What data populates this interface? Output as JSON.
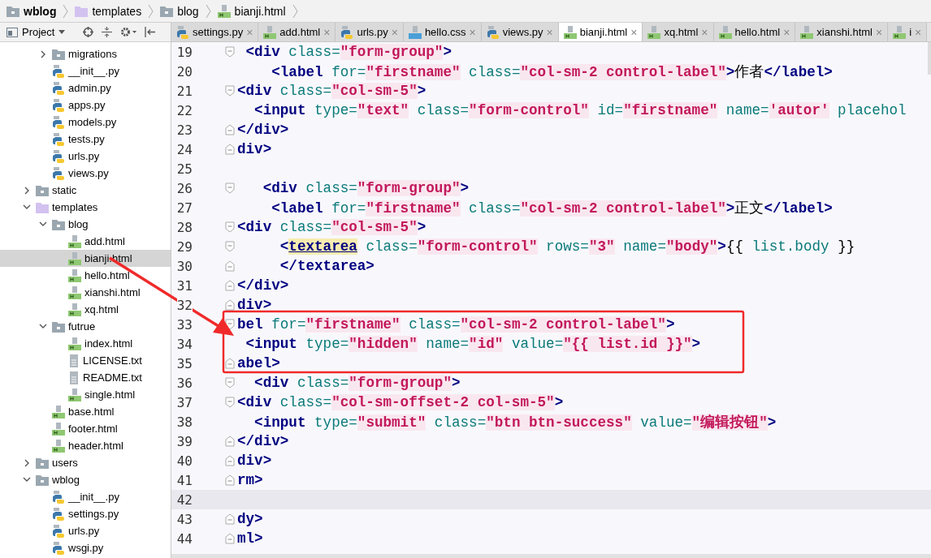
{
  "breadcrumb": [
    {
      "label": "wblog",
      "kind": "folder",
      "bold": true
    },
    {
      "label": "templates",
      "kind": "template-folder",
      "bold": false
    },
    {
      "label": "blog",
      "kind": "folder",
      "bold": false
    },
    {
      "label": "bianji.html",
      "kind": "html",
      "bold": false
    }
  ],
  "project_toolbar": {
    "title": "Project"
  },
  "tree_continued": [
    {
      "label": "migrations",
      "kind": "folder",
      "expanded": false,
      "selected": false
    },
    {
      "label": "__init__.py",
      "kind": "py",
      "selected": false
    },
    {
      "label": "admin.py",
      "kind": "py",
      "selected": false
    },
    {
      "label": "apps.py",
      "kind": "py",
      "selected": false
    },
    {
      "label": "models.py",
      "kind": "py",
      "selected": false
    },
    {
      "label": "tests.py",
      "kind": "py",
      "selected": false
    },
    {
      "label": "urls.py",
      "kind": "py",
      "selected": false
    },
    {
      "label": "views.py",
      "kind": "py",
      "selected": false
    }
  ],
  "tree": [
    {
      "label": "static",
      "kind": "folder",
      "expanded": false,
      "selected": false
    },
    {
      "label": "templates",
      "kind": "template-folder",
      "expanded": true,
      "selected": false,
      "children": [
        {
          "label": "blog",
          "kind": "folder",
          "expanded": true,
          "selected": false,
          "children": [
            {
              "label": "add.html",
              "kind": "html",
              "selected": false
            },
            {
              "label": "bianji.html",
              "kind": "html",
              "selected": true
            },
            {
              "label": "hello.html",
              "kind": "html",
              "selected": false
            },
            {
              "label": "xianshi.html",
              "kind": "html",
              "selected": false
            },
            {
              "label": "xq.html",
              "kind": "html",
              "selected": false
            }
          ]
        },
        {
          "label": "futrue",
          "kind": "folder",
          "expanded": true,
          "selected": false,
          "children": [
            {
              "label": "index.html",
              "kind": "html",
              "selected": false
            },
            {
              "label": "LICENSE.txt",
              "kind": "txt",
              "selected": false
            },
            {
              "label": "README.txt",
              "kind": "txt",
              "selected": false
            },
            {
              "label": "single.html",
              "kind": "html",
              "selected": false
            }
          ]
        },
        {
          "label": "base.html",
          "kind": "html",
          "selected": false
        },
        {
          "label": "footer.html",
          "kind": "html",
          "selected": false
        },
        {
          "label": "header.html",
          "kind": "html",
          "selected": false
        }
      ]
    },
    {
      "label": "users",
      "kind": "folder",
      "expanded": false,
      "selected": false
    },
    {
      "label": "wblog",
      "kind": "folder",
      "expanded": true,
      "selected": false,
      "children": [
        {
          "label": "__init__.py",
          "kind": "py",
          "selected": false
        },
        {
          "label": "settings.py",
          "kind": "py",
          "selected": false
        },
        {
          "label": "urls.py",
          "kind": "py",
          "selected": false
        },
        {
          "label": "wsgi.py",
          "kind": "py",
          "selected": false
        }
      ]
    }
  ],
  "tabs": [
    {
      "label": "settings.py",
      "kind": "py",
      "selected": false
    },
    {
      "label": "add.html",
      "kind": "html",
      "selected": false
    },
    {
      "label": "urls.py",
      "kind": "py",
      "selected": false
    },
    {
      "label": "hello.css",
      "kind": "css",
      "selected": false
    },
    {
      "label": "views.py",
      "kind": "py",
      "selected": false
    },
    {
      "label": "bianji.html",
      "kind": "html",
      "selected": true
    },
    {
      "label": "xq.html",
      "kind": "html",
      "selected": false
    },
    {
      "label": "hello.html",
      "kind": "html",
      "selected": false
    },
    {
      "label": "xianshi.html",
      "kind": "html",
      "selected": false
    },
    {
      "label": "i",
      "kind": "html",
      "selected": false
    }
  ],
  "tab_close": "×",
  "code_lines": [
    {
      "number": "19",
      "fold_start": true,
      "fold_end": false,
      "current": false,
      "tokens": [
        {
          "kind": "tag",
          "text": " <div"
        },
        {
          "kind": "attr",
          "text": " class="
        },
        {
          "kind": "str",
          "text": "\"form-group\""
        },
        {
          "kind": "tag",
          "text": ">"
        }
      ]
    },
    {
      "number": "20",
      "fold_start": false,
      "fold_end": false,
      "current": false,
      "tokens": [
        {
          "kind": "tag",
          "text": "    <label"
        },
        {
          "kind": "attr",
          "text": " for="
        },
        {
          "kind": "str",
          "text": "\"firstname\""
        },
        {
          "kind": "attr",
          "text": " class="
        },
        {
          "kind": "str",
          "text": "\"col-sm-2 control-label\""
        },
        {
          "kind": "tag",
          "text": ">"
        },
        {
          "kind": "text",
          "text": "作者"
        },
        {
          "kind": "tag",
          "text": "</label>"
        }
      ]
    },
    {
      "number": "21",
      "fold_start": true,
      "fold_end": false,
      "current": false,
      "tokens": [
        {
          "kind": "tag",
          "text": "<div"
        },
        {
          "kind": "attr",
          "text": " class="
        },
        {
          "kind": "str",
          "text": "\"col-sm-5\""
        },
        {
          "kind": "tag",
          "text": ">"
        }
      ]
    },
    {
      "number": "22",
      "fold_start": false,
      "fold_end": false,
      "current": false,
      "tokens": [
        {
          "kind": "tag",
          "text": "  <input"
        },
        {
          "kind": "attr",
          "text": " type="
        },
        {
          "kind": "str",
          "text": "\"text\""
        },
        {
          "kind": "attr",
          "text": " class="
        },
        {
          "kind": "str",
          "text": "\"form-control\""
        },
        {
          "kind": "attr",
          "text": " id="
        },
        {
          "kind": "str",
          "text": "\"firstname\""
        },
        {
          "kind": "attr",
          "text": " name="
        },
        {
          "kind": "str",
          "text": "'autor'"
        },
        {
          "kind": "attr",
          "text": " placehol"
        }
      ]
    },
    {
      "number": "23",
      "fold_start": false,
      "fold_end": true,
      "current": false,
      "tokens": [
        {
          "kind": "tag",
          "text": "</div>"
        }
      ]
    },
    {
      "number": "24",
      "fold_start": false,
      "fold_end": true,
      "current": false,
      "tokens": [
        {
          "kind": "tag",
          "text": "div>"
        }
      ]
    },
    {
      "number": "25",
      "fold_start": false,
      "fold_end": false,
      "current": false
    },
    {
      "number": "26",
      "fold_start": true,
      "fold_end": false,
      "current": false,
      "tokens": [
        {
          "kind": "tag",
          "text": "   <div"
        },
        {
          "kind": "attr",
          "text": " class="
        },
        {
          "kind": "str",
          "text": "\"form-group\""
        },
        {
          "kind": "tag",
          "text": ">"
        }
      ]
    },
    {
      "number": "27",
      "fold_start": false,
      "fold_end": false,
      "current": false,
      "tokens": [
        {
          "kind": "tag",
          "text": "    <label"
        },
        {
          "kind": "attr",
          "text": " for="
        },
        {
          "kind": "str",
          "text": "\"firstname\""
        },
        {
          "kind": "attr",
          "text": " class="
        },
        {
          "kind": "str",
          "text": "\"col-sm-2 control-label\""
        },
        {
          "kind": "tag",
          "text": ">"
        },
        {
          "kind": "text",
          "text": "正文"
        },
        {
          "kind": "tag",
          "text": "</label>"
        }
      ]
    },
    {
      "number": "28",
      "fold_start": true,
      "fold_end": false,
      "current": false,
      "tokens": [
        {
          "kind": "tag",
          "text": "<div"
        },
        {
          "kind": "attr",
          "text": " class="
        },
        {
          "kind": "str",
          "text": "\"col-sm-5\""
        },
        {
          "kind": "tag",
          "text": ">"
        }
      ]
    },
    {
      "number": "29",
      "fold_start": true,
      "fold_end": false,
      "current": false,
      "tokens": [
        {
          "kind": "tag",
          "text": "     <"
        },
        {
          "kind": "match",
          "text": "textarea"
        },
        {
          "kind": "attr",
          "text": " class="
        },
        {
          "kind": "str",
          "text": "\"form-control\""
        },
        {
          "kind": "attr",
          "text": " rows="
        },
        {
          "kind": "str",
          "text": "\"3\""
        },
        {
          "kind": "attr",
          "text": " name="
        },
        {
          "kind": "str",
          "text": "\"body\""
        },
        {
          "kind": "tag",
          "text": ">"
        },
        {
          "kind": "text",
          "text": "{{ "
        },
        {
          "kind": "var",
          "text": "list.body"
        },
        {
          "kind": "text",
          "text": " }}"
        }
      ]
    },
    {
      "number": "30",
      "fold_start": false,
      "fold_end": true,
      "current": false,
      "tokens": [
        {
          "kind": "tag",
          "text": "     </textarea>"
        }
      ]
    },
    {
      "number": "31",
      "fold_start": false,
      "fold_end": true,
      "current": false,
      "tokens": [
        {
          "kind": "tag",
          "text": "</div>"
        }
      ]
    },
    {
      "number": "32",
      "fold_start": false,
      "fold_end": true,
      "current": false,
      "tokens": [
        {
          "kind": "tag",
          "text": "div>"
        }
      ]
    },
    {
      "number": "33",
      "fold_start": true,
      "fold_end": false,
      "current": false,
      "tokens": [
        {
          "kind": "tag",
          "text": "bel"
        },
        {
          "kind": "attr",
          "text": " for="
        },
        {
          "kind": "str",
          "text": "\"firstname\""
        },
        {
          "kind": "attr",
          "text": " class="
        },
        {
          "kind": "str",
          "text": "\"col-sm-2 control-label\""
        },
        {
          "kind": "tag",
          "text": ">"
        }
      ]
    },
    {
      "number": "34",
      "fold_start": false,
      "fold_end": false,
      "current": false,
      "tokens": [
        {
          "kind": "tag",
          "text": " <input"
        },
        {
          "kind": "attr",
          "text": " type="
        },
        {
          "kind": "str",
          "text": "\"hidden\""
        },
        {
          "kind": "attr",
          "text": " name="
        },
        {
          "kind": "str",
          "text": "\"id\""
        },
        {
          "kind": "attr",
          "text": " value="
        },
        {
          "kind": "str",
          "text": "\"{{ list.id }}\""
        },
        {
          "kind": "tag",
          "text": ">"
        }
      ]
    },
    {
      "number": "35",
      "fold_start": false,
      "fold_end": true,
      "current": false,
      "tokens": [
        {
          "kind": "tag",
          "text": "abel>"
        }
      ]
    },
    {
      "number": "36",
      "fold_start": true,
      "fold_end": false,
      "current": false,
      "tokens": [
        {
          "kind": "tag",
          "text": "  <div"
        },
        {
          "kind": "attr",
          "text": " class="
        },
        {
          "kind": "str",
          "text": "\"form-group\""
        },
        {
          "kind": "tag",
          "text": ">"
        }
      ]
    },
    {
      "number": "37",
      "fold_start": true,
      "fold_end": false,
      "current": false,
      "tokens": [
        {
          "kind": "tag",
          "text": "<div"
        },
        {
          "kind": "attr",
          "text": " class="
        },
        {
          "kind": "str",
          "text": "\"col-sm-offset-2 col-sm-5\""
        },
        {
          "kind": "tag",
          "text": ">"
        }
      ]
    },
    {
      "number": "38",
      "fold_start": false,
      "fold_end": false,
      "current": false,
      "tokens": [
        {
          "kind": "tag",
          "text": "  <input"
        },
        {
          "kind": "attr",
          "text": " type="
        },
        {
          "kind": "str",
          "text": "\"submit\""
        },
        {
          "kind": "attr",
          "text": " class="
        },
        {
          "kind": "str",
          "text": "\"btn btn-success\""
        },
        {
          "kind": "attr",
          "text": " value="
        },
        {
          "kind": "str",
          "text": "\"编辑按钮\""
        },
        {
          "kind": "tag",
          "text": ">"
        }
      ]
    },
    {
      "number": "39",
      "fold_start": false,
      "fold_end": true,
      "current": false,
      "tokens": [
        {
          "kind": "tag",
          "text": "</div>"
        }
      ]
    },
    {
      "number": "40",
      "fold_start": false,
      "fold_end": true,
      "current": false,
      "tokens": [
        {
          "kind": "tag",
          "text": "div>"
        }
      ]
    },
    {
      "number": "41",
      "fold_start": false,
      "fold_end": true,
      "current": false,
      "tokens": [
        {
          "kind": "tag",
          "text": "rm>"
        }
      ]
    },
    {
      "number": "42",
      "fold_start": false,
      "fold_end": false,
      "current": true
    },
    {
      "number": "43",
      "fold_start": false,
      "fold_end": true,
      "current": false,
      "tokens": [
        {
          "kind": "tag",
          "text": "dy>"
        }
      ]
    },
    {
      "number": "44",
      "fold_start": false,
      "fold_end": true,
      "current": false,
      "tokens": [
        {
          "kind": "tag",
          "text": "ml>"
        }
      ]
    }
  ]
}
